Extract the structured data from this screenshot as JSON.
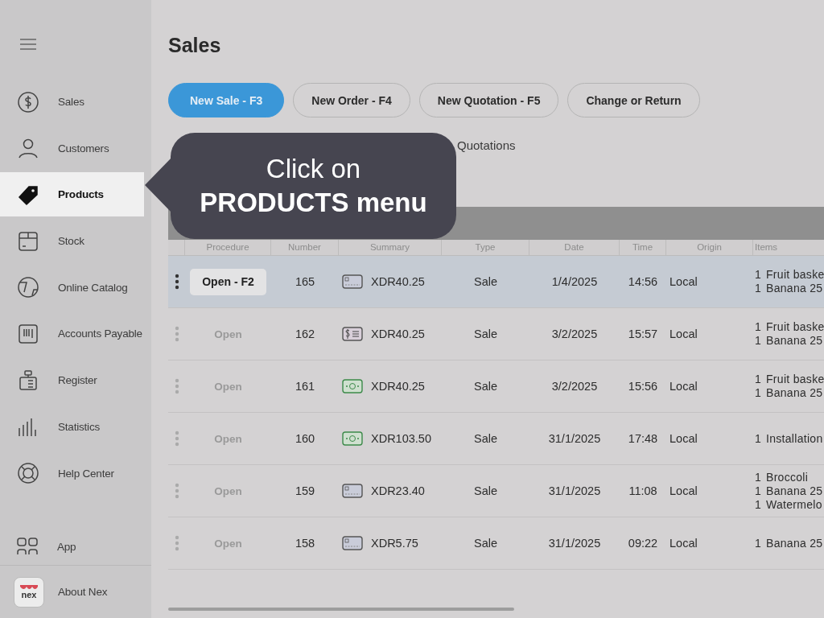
{
  "sidebar": {
    "items": [
      {
        "label": "Sales",
        "kind": "dollar",
        "selected": false
      },
      {
        "label": "Customers",
        "kind": "person",
        "selected": false
      },
      {
        "label": "Products",
        "kind": "tag",
        "selected": true
      },
      {
        "label": "Stock",
        "kind": "box",
        "selected": false
      },
      {
        "label": "Online Catalog",
        "kind": "globe",
        "selected": false
      },
      {
        "label": "Accounts Payable",
        "kind": "barcode",
        "selected": false
      },
      {
        "label": "Register",
        "kind": "register",
        "selected": false
      },
      {
        "label": "Statistics",
        "kind": "bars",
        "selected": false
      },
      {
        "label": "Help Center",
        "kind": "lifebuoy",
        "selected": false
      }
    ],
    "app": {
      "label": "App"
    },
    "about": {
      "label": "About Nex",
      "logo_text": "nex"
    }
  },
  "title": "Sales",
  "buttons": [
    {
      "label": "New Sale - F3",
      "primary": true
    },
    {
      "label": "New Order - F4",
      "primary": false
    },
    {
      "label": "New Quotation - F5",
      "primary": false
    },
    {
      "label": "Change or Return",
      "primary": false
    }
  ],
  "tabs": [
    {
      "label": "Quotations",
      "selected": false
    }
  ],
  "callout": {
    "text": "Click on **PRODUCTS menu**"
  },
  "table": {
    "columns": [
      "Procedure",
      "Number",
      "Summary",
      "Type",
      "Date",
      "Time",
      "Origin",
      "Items"
    ],
    "rows": [
      {
        "selected": true,
        "procedure": "Open - F2",
        "number": "165",
        "kind": "card",
        "summary": "XDR40.25",
        "type": "Sale",
        "date": "1/4/2025",
        "time": "14:56",
        "origin": "Local",
        "items": [
          {
            "qty": "1",
            "name": "Fruit baske"
          },
          {
            "qty": "1",
            "name": "Banana 25"
          }
        ]
      },
      {
        "selected": false,
        "procedure": "Open",
        "number": "162",
        "kind": "voucher",
        "summary": "XDR40.25",
        "type": "Sale",
        "date": "3/2/2025",
        "time": "15:57",
        "origin": "Local",
        "items": [
          {
            "qty": "1",
            "name": "Fruit baske"
          },
          {
            "qty": "1",
            "name": "Banana 25"
          }
        ]
      },
      {
        "selected": false,
        "procedure": "Open",
        "number": "161",
        "kind": "cash",
        "summary": "XDR40.25",
        "type": "Sale",
        "date": "3/2/2025",
        "time": "15:56",
        "origin": "Local",
        "items": [
          {
            "qty": "1",
            "name": "Fruit baske"
          },
          {
            "qty": "1",
            "name": "Banana 25"
          }
        ]
      },
      {
        "selected": false,
        "procedure": "Open",
        "number": "160",
        "kind": "cash",
        "summary": "XDR103.50",
        "type": "Sale",
        "date": "31/1/2025",
        "time": "17:48",
        "origin": "Local",
        "items": [
          {
            "qty": "1",
            "name": "Installation"
          }
        ]
      },
      {
        "selected": false,
        "procedure": "Open",
        "number": "159",
        "kind": "card",
        "summary": "XDR23.40",
        "type": "Sale",
        "date": "31/1/2025",
        "time": "11:08",
        "origin": "Local",
        "items": [
          {
            "qty": "1",
            "name": "Broccoli"
          },
          {
            "qty": "1",
            "name": "Banana 25"
          },
          {
            "qty": "1",
            "name": "Watermelo"
          }
        ]
      },
      {
        "selected": false,
        "procedure": "Open",
        "number": "158",
        "kind": "card",
        "summary": "XDR5.75",
        "type": "Sale",
        "date": "31/1/2025",
        "time": "09:22",
        "origin": "Local",
        "items": [
          {
            "qty": "1",
            "name": "Banana 25"
          }
        ]
      }
    ]
  }
}
